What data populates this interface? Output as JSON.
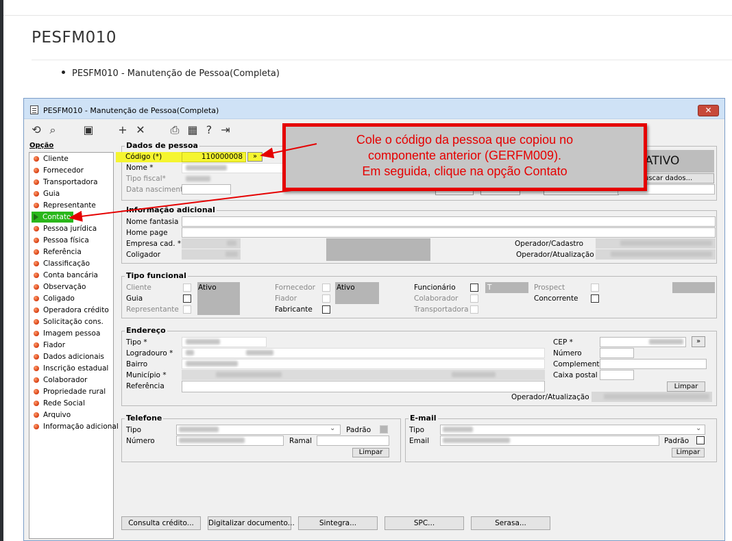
{
  "page": {
    "title": "PESFM010",
    "bullet": "PESFM010 - Manutenção de Pessoa(Completa)"
  },
  "window": {
    "title": "PESFM010 - Manutenção de Pessoa(Completa)",
    "close_label": "✕"
  },
  "toolbar": {
    "icons": [
      "undo-icon",
      "search-icon",
      "save-icon",
      "add-icon",
      "delete-icon",
      "print-icon",
      "calendar-icon",
      "help-icon",
      "exit-icon"
    ],
    "glyphs": [
      "⟲",
      "⌕",
      "▣",
      "+",
      "✕",
      "⎙",
      "▦",
      "?",
      "⇥"
    ]
  },
  "sidebar": {
    "label": "Opção",
    "items": [
      "Cliente",
      "Fornecedor",
      "Transportadora",
      "Guia",
      "Representante",
      "Contato",
      "Pessoa jurídica",
      "Pessoa física",
      "Referência",
      "Classificação",
      "Conta bancária",
      "Observação",
      "Coligado",
      "Operadora crédito",
      "Solicitação cons.",
      "Imagem pessoa",
      "Fiador",
      "Dados adicionais",
      "Inscrição estadual",
      "Colaborador",
      "Propriedade rural",
      "Rede Social",
      "Arquivo",
      "Informação adicional"
    ],
    "active_item": "Contato"
  },
  "dados_pessoa": {
    "legend": "Dados de pessoa",
    "codigo_label": "Código (*)",
    "codigo_value": "110000008",
    "codigo_btn": "»",
    "nome_label": "Nome *",
    "tipo_fiscal_label": "Tipo fiscal*",
    "data_nascimento_label": "Data nascimento",
    "status": "ATIVO",
    "buscar_label": "uscar dados..."
  },
  "info_adicional": {
    "legend": "Informação adicional",
    "nome_fantasia": "Nome fantasia",
    "home_page": "Home page",
    "empresa_cad": "Empresa cad. *",
    "coligador": "Coligador",
    "operador_cadastro": "Operador/Cadastro",
    "operador_atualizacao": "Operador/Atualização"
  },
  "tipo_funcional": {
    "legend": "Tipo funcional",
    "cliente": "Cliente",
    "cliente_status": "Ativo",
    "guia": "Guia",
    "representante": "Representante",
    "fornecedor": "Fornecedor",
    "fornecedor_status": "Ativo",
    "fiador": "Fiador",
    "fabricante": "Fabricante",
    "funcionario": "Funcionário",
    "funcionario_mark": "T",
    "colaborador": "Colaborador",
    "transportadora": "Transportadora",
    "prospect": "Prospect",
    "concorrente": "Concorrente"
  },
  "endereco": {
    "legend": "Endereço",
    "tipo": "Tipo *",
    "logradouro": "Logradouro *",
    "bairro": "Bairro",
    "municipio": "Município *",
    "referencia": "Referência",
    "cep": "CEP *",
    "numero": "Número",
    "complemento": "Complemento",
    "caixa_postal": "Caixa postal",
    "limpar": "Limpar",
    "operador_atualizacao": "Operador/Atualização",
    "cep_btn": "»"
  },
  "telefone": {
    "legend": "Telefone",
    "tipo": "Tipo",
    "padrao": "Padrão",
    "numero": "Número",
    "ramal": "Ramal",
    "limpar": "Limpar"
  },
  "email": {
    "legend": "E-mail",
    "tipo": "Tipo",
    "email": "Email",
    "padrao": "Padrão",
    "limpar": "Limpar"
  },
  "bottom_buttons": [
    "Consulta crédito...",
    "Digitalizar documento...",
    "Sintegra...",
    "SPC...",
    "Serasa..."
  ],
  "callout": {
    "line1": "Cole o código da pessoa que copiou no",
    "line2": "componente anterior (GERFM009).",
    "line3": "Em seguida, clique na opção Contato",
    "color": "#e50000"
  }
}
